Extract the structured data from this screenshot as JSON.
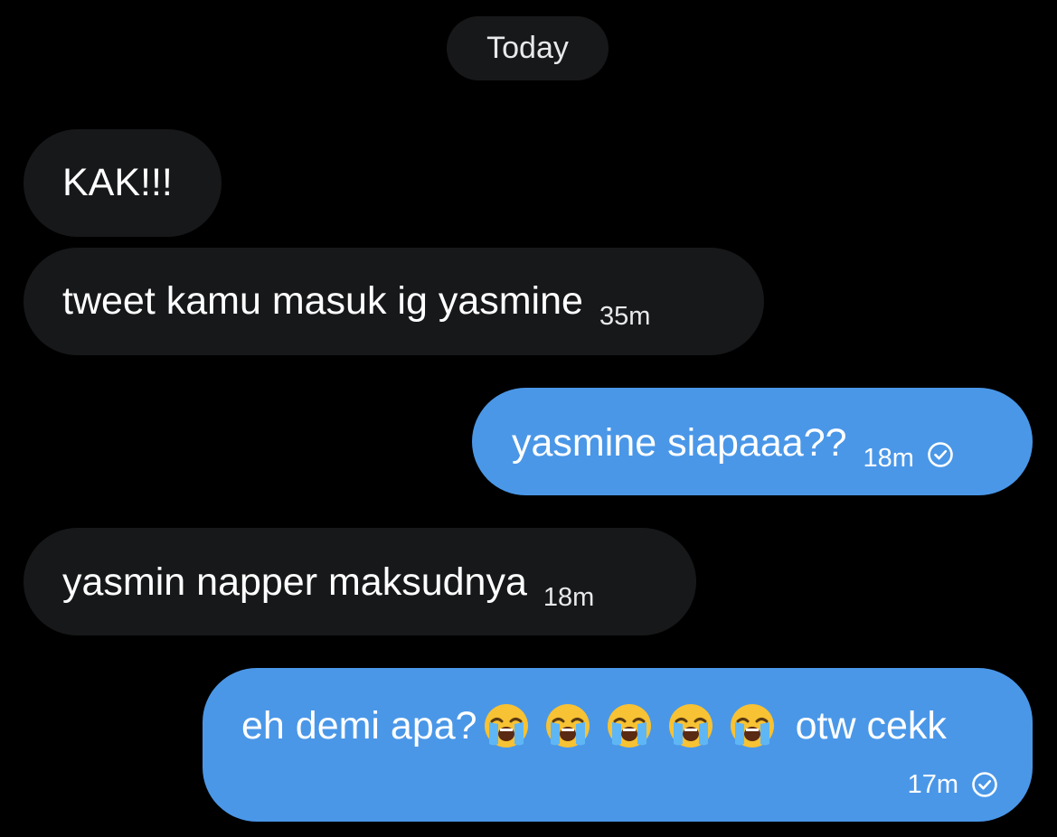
{
  "date_separator": "Today",
  "colors": {
    "background": "#000000",
    "incoming_bubble": "#17181a",
    "outgoing_bubble": "#4a97e8",
    "text": "#ffffff"
  },
  "messages": [
    {
      "direction": "incoming",
      "text": "KAK!!!",
      "time": ""
    },
    {
      "direction": "incoming",
      "text": "tweet kamu masuk ig yasmine",
      "time": "35m"
    },
    {
      "direction": "outgoing",
      "text": "yasmine siapaaa??",
      "time": "18m",
      "status_icon": "read-check-icon"
    },
    {
      "direction": "incoming",
      "text": "yasmin napper maksudnya",
      "time": "18m"
    },
    {
      "direction": "outgoing",
      "text": "eh demi apa?",
      "emoji": [
        "loudly-crying-face",
        "loudly-crying-face",
        "loudly-crying-face",
        "loudly-crying-face",
        "loudly-crying-face"
      ],
      "text_after": "otw cekk",
      "time": "17m",
      "status_icon": "read-check-icon"
    }
  ]
}
